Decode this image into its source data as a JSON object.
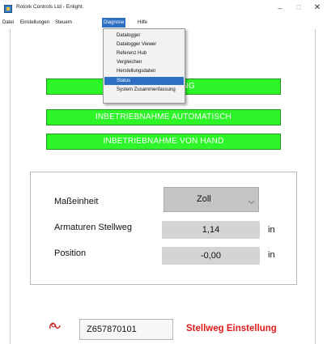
{
  "window": {
    "title": "Rotork Controls Ltd - Enlight.",
    "minimize": "–",
    "maximize": "☐",
    "close": "✕"
  },
  "menubar": {
    "items": [
      "Datei",
      "Einstellungen",
      "Steuern",
      "Diagnose",
      "Hilfe"
    ],
    "active_index": 3
  },
  "diagnose_menu": {
    "items": [
      "Datalogger",
      "Datalogger Viewer",
      "Referenz Hub",
      "Vergleichen",
      "Herstellungsdaten",
      "Status",
      "System Zusammenfassung"
    ],
    "highlighted_index": 5
  },
  "commissioning": {
    "btn1_visible": "UNG",
    "btn2": "INBETRIEBNAHME AUTOMATISCH",
    "btn3": "INBETRIEBNAHME VON HAND"
  },
  "settings_panel": {
    "unit_label": "Maßeinheit",
    "unit_value": "Zoll",
    "stroke_label": "Armaturen Stellweg",
    "stroke_value": "1,14",
    "stroke_unit": "in",
    "position_label": "Position",
    "position_value": "-0,00",
    "position_unit": "in"
  },
  "footer": {
    "serial": "Z657870101",
    "status": "Stellweg Einstellung"
  },
  "colors": {
    "green_button": "#2ef52a",
    "menu_highlight": "#2f6fc4",
    "status_red": "#e01b1b",
    "logo": "#c41e1e"
  }
}
